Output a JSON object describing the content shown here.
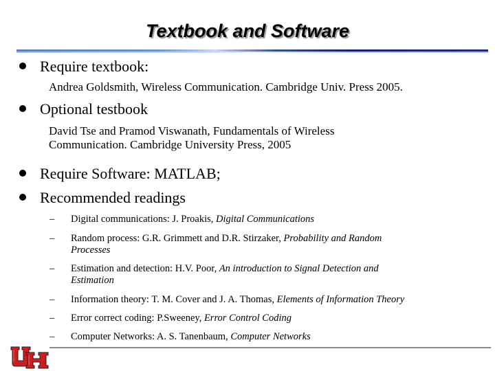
{
  "slide": {
    "title": "Textbook and Software",
    "bullets": [
      {
        "label": "Require textbook:",
        "detail": [
          "Andrea Goldsmith, Wireless Communication. Cambridge Univ. Press 2005."
        ]
      },
      {
        "label": "Optional testbook",
        "detail": [
          "David Tse and Pramod Viswanath, Fundamentals of Wireless",
          "Communication. Cambridge University Press, 2005"
        ]
      },
      {
        "label": "Require Software: MATLAB;"
      },
      {
        "label": "Recommended readings"
      }
    ],
    "readings": [
      {
        "dash": "–",
        "prefix": "Digital communications: J. Proakis, ",
        "title": "Digital Communications",
        "title2": ""
      },
      {
        "dash": "–",
        "prefix": "Random process: G.R. Grimmett and D.R. Stirzaker, ",
        "title": "Probability and Random",
        "title2": "Processes"
      },
      {
        "dash": "–",
        "prefix": "Estimation and detection: H.V. Poor, ",
        "title": "An introduction to Signal Detection and",
        "title2": "Estimation"
      },
      {
        "dash": "–",
        "prefix": "Information theory: T. M. Cover and J. A. Thomas, ",
        "title": "Elements of Information Theory",
        "title2": ""
      },
      {
        "dash": "–",
        "prefix": "Error correct coding: P.Sweeney, ",
        "title": "Error Control Coding",
        "title2": ""
      },
      {
        "dash": "–",
        "prefix": "Computer Networks: A. S. Tanenbaum, ",
        "title": "Computer Networks",
        "title2": ""
      }
    ]
  },
  "logo": {
    "name": "University of Houston UH logo",
    "colors": {
      "fill": "#d01c1f",
      "outline": "#000000"
    }
  },
  "colors": {
    "rule_dark": "#1c2a78",
    "rule_light": "#6d92c6",
    "footer_rule": "#8a8a8a"
  }
}
